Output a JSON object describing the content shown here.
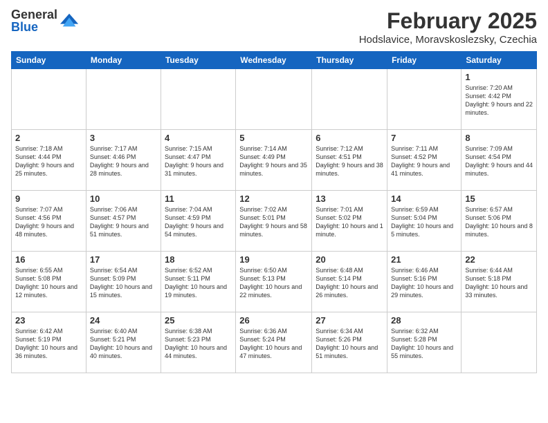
{
  "logo": {
    "general": "General",
    "blue": "Blue"
  },
  "title": "February 2025",
  "subtitle": "Hodslavice, Moravskoslezsky, Czechia",
  "days_of_week": [
    "Sunday",
    "Monday",
    "Tuesday",
    "Wednesday",
    "Thursday",
    "Friday",
    "Saturday"
  ],
  "weeks": [
    [
      {
        "day": "",
        "content": ""
      },
      {
        "day": "",
        "content": ""
      },
      {
        "day": "",
        "content": ""
      },
      {
        "day": "",
        "content": ""
      },
      {
        "day": "",
        "content": ""
      },
      {
        "day": "",
        "content": ""
      },
      {
        "day": "1",
        "content": "Sunrise: 7:20 AM\nSunset: 4:42 PM\nDaylight: 9 hours and 22 minutes."
      }
    ],
    [
      {
        "day": "2",
        "content": "Sunrise: 7:18 AM\nSunset: 4:44 PM\nDaylight: 9 hours and 25 minutes."
      },
      {
        "day": "3",
        "content": "Sunrise: 7:17 AM\nSunset: 4:46 PM\nDaylight: 9 hours and 28 minutes."
      },
      {
        "day": "4",
        "content": "Sunrise: 7:15 AM\nSunset: 4:47 PM\nDaylight: 9 hours and 31 minutes."
      },
      {
        "day": "5",
        "content": "Sunrise: 7:14 AM\nSunset: 4:49 PM\nDaylight: 9 hours and 35 minutes."
      },
      {
        "day": "6",
        "content": "Sunrise: 7:12 AM\nSunset: 4:51 PM\nDaylight: 9 hours and 38 minutes."
      },
      {
        "day": "7",
        "content": "Sunrise: 7:11 AM\nSunset: 4:52 PM\nDaylight: 9 hours and 41 minutes."
      },
      {
        "day": "8",
        "content": "Sunrise: 7:09 AM\nSunset: 4:54 PM\nDaylight: 9 hours and 44 minutes."
      }
    ],
    [
      {
        "day": "9",
        "content": "Sunrise: 7:07 AM\nSunset: 4:56 PM\nDaylight: 9 hours and 48 minutes."
      },
      {
        "day": "10",
        "content": "Sunrise: 7:06 AM\nSunset: 4:57 PM\nDaylight: 9 hours and 51 minutes."
      },
      {
        "day": "11",
        "content": "Sunrise: 7:04 AM\nSunset: 4:59 PM\nDaylight: 9 hours and 54 minutes."
      },
      {
        "day": "12",
        "content": "Sunrise: 7:02 AM\nSunset: 5:01 PM\nDaylight: 9 hours and 58 minutes."
      },
      {
        "day": "13",
        "content": "Sunrise: 7:01 AM\nSunset: 5:02 PM\nDaylight: 10 hours and 1 minute."
      },
      {
        "day": "14",
        "content": "Sunrise: 6:59 AM\nSunset: 5:04 PM\nDaylight: 10 hours and 5 minutes."
      },
      {
        "day": "15",
        "content": "Sunrise: 6:57 AM\nSunset: 5:06 PM\nDaylight: 10 hours and 8 minutes."
      }
    ],
    [
      {
        "day": "16",
        "content": "Sunrise: 6:55 AM\nSunset: 5:08 PM\nDaylight: 10 hours and 12 minutes."
      },
      {
        "day": "17",
        "content": "Sunrise: 6:54 AM\nSunset: 5:09 PM\nDaylight: 10 hours and 15 minutes."
      },
      {
        "day": "18",
        "content": "Sunrise: 6:52 AM\nSunset: 5:11 PM\nDaylight: 10 hours and 19 minutes."
      },
      {
        "day": "19",
        "content": "Sunrise: 6:50 AM\nSunset: 5:13 PM\nDaylight: 10 hours and 22 minutes."
      },
      {
        "day": "20",
        "content": "Sunrise: 6:48 AM\nSunset: 5:14 PM\nDaylight: 10 hours and 26 minutes."
      },
      {
        "day": "21",
        "content": "Sunrise: 6:46 AM\nSunset: 5:16 PM\nDaylight: 10 hours and 29 minutes."
      },
      {
        "day": "22",
        "content": "Sunrise: 6:44 AM\nSunset: 5:18 PM\nDaylight: 10 hours and 33 minutes."
      }
    ],
    [
      {
        "day": "23",
        "content": "Sunrise: 6:42 AM\nSunset: 5:19 PM\nDaylight: 10 hours and 36 minutes."
      },
      {
        "day": "24",
        "content": "Sunrise: 6:40 AM\nSunset: 5:21 PM\nDaylight: 10 hours and 40 minutes."
      },
      {
        "day": "25",
        "content": "Sunrise: 6:38 AM\nSunset: 5:23 PM\nDaylight: 10 hours and 44 minutes."
      },
      {
        "day": "26",
        "content": "Sunrise: 6:36 AM\nSunset: 5:24 PM\nDaylight: 10 hours and 47 minutes."
      },
      {
        "day": "27",
        "content": "Sunrise: 6:34 AM\nSunset: 5:26 PM\nDaylight: 10 hours and 51 minutes."
      },
      {
        "day": "28",
        "content": "Sunrise: 6:32 AM\nSunset: 5:28 PM\nDaylight: 10 hours and 55 minutes."
      },
      {
        "day": "",
        "content": ""
      }
    ]
  ]
}
